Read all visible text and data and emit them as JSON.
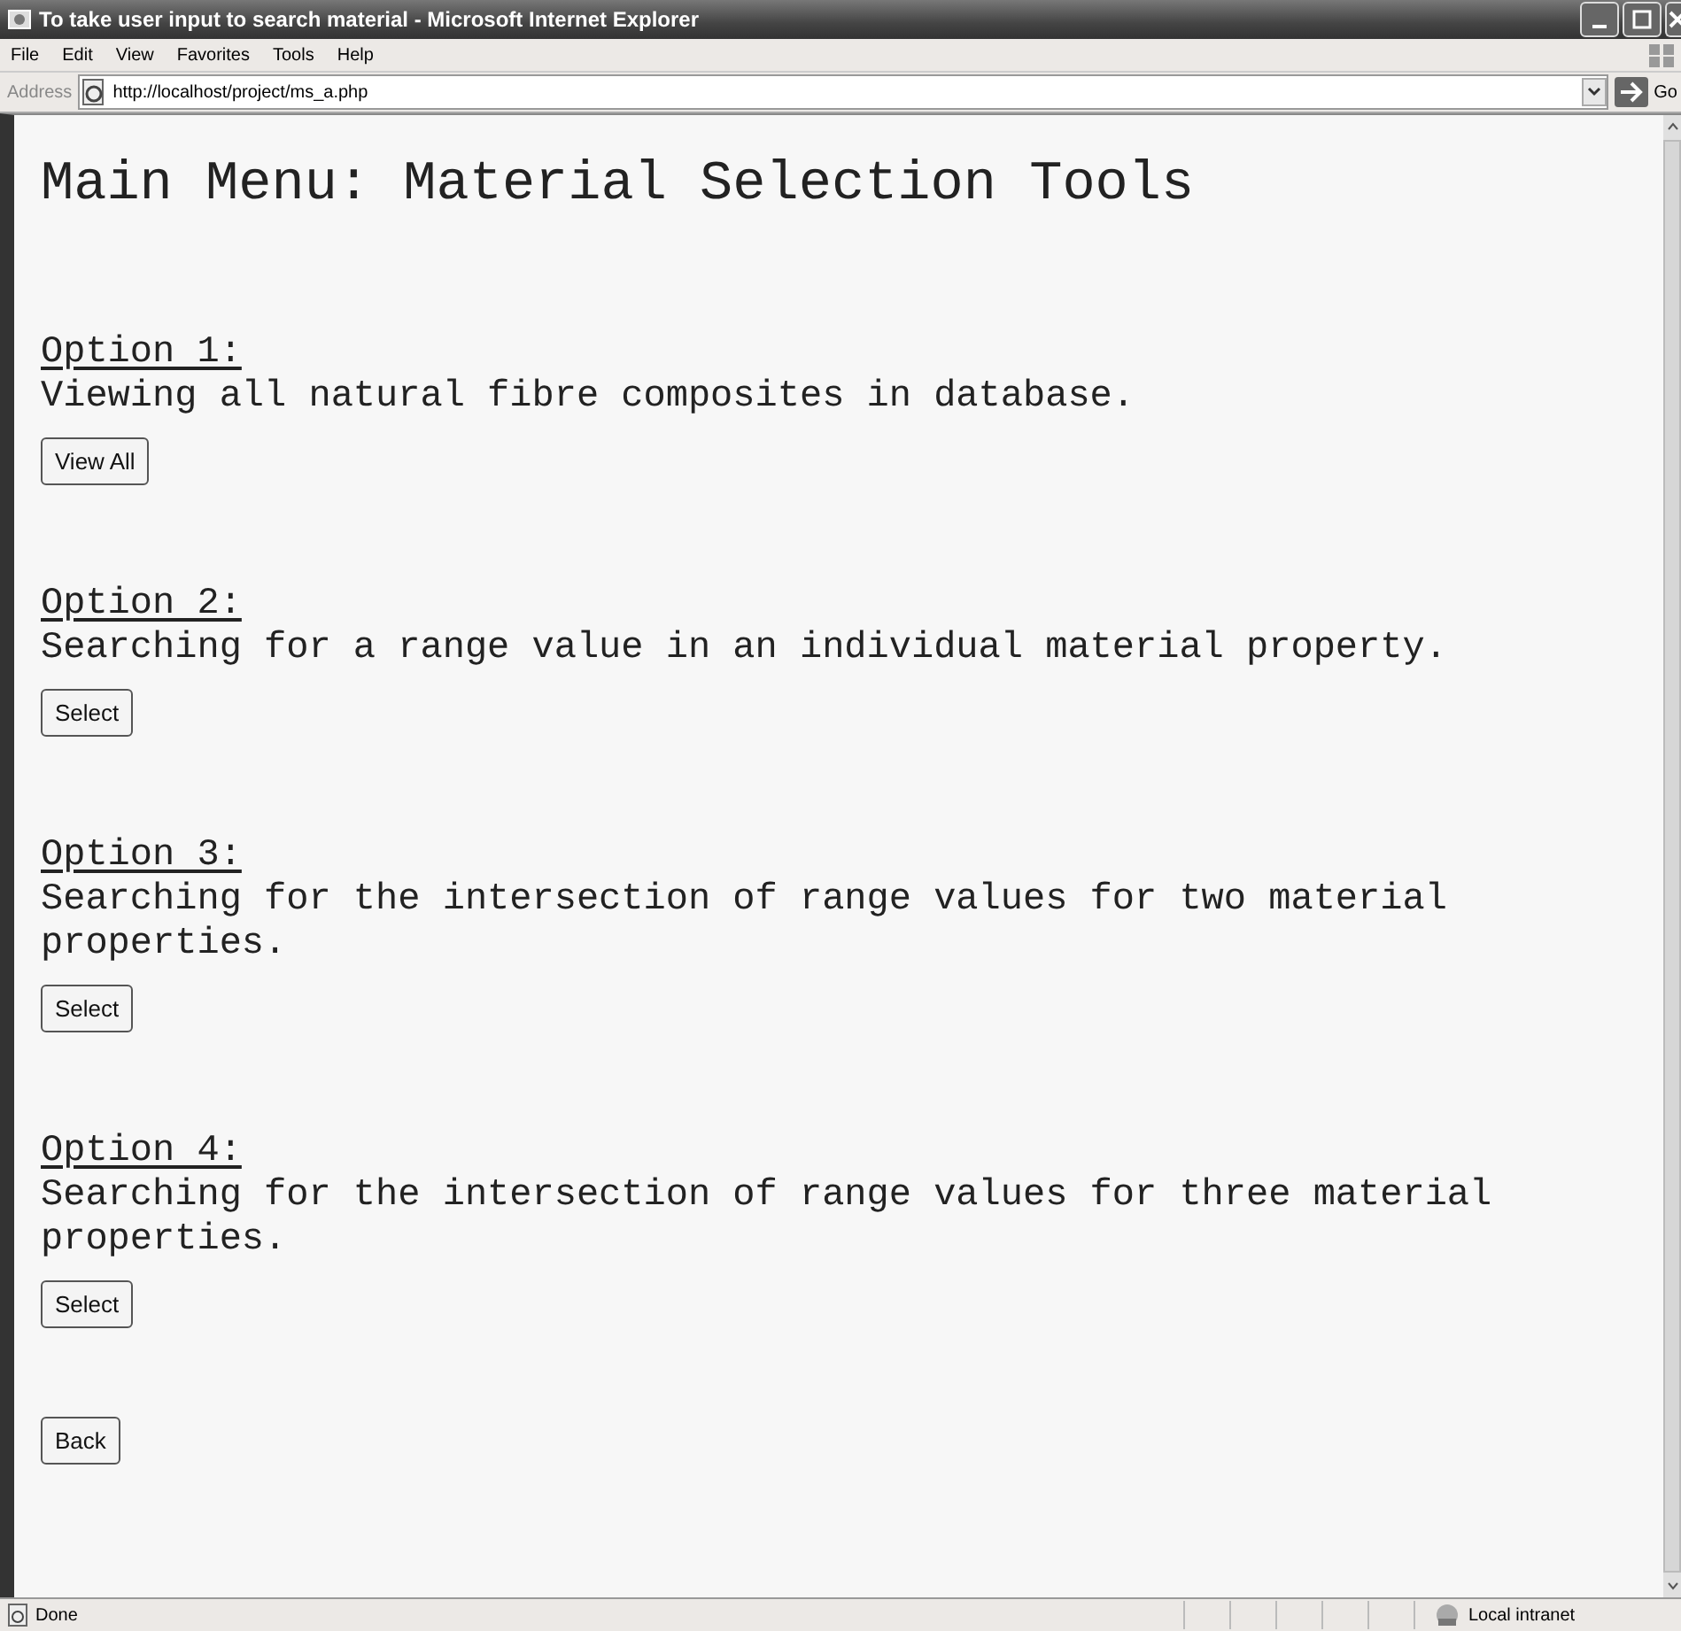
{
  "window": {
    "title": "To take user input to search material - Microsoft Internet Explorer"
  },
  "menu": [
    "File",
    "Edit",
    "View",
    "Favorites",
    "Tools",
    "Help"
  ],
  "address_bar": {
    "label": "Address",
    "url": "http://localhost/project/ms_a.php",
    "go": "Go"
  },
  "page": {
    "heading": "Main Menu: Material Selection Tools",
    "options": [
      {
        "label": "Option 1:",
        "description": "Viewing all natural fibre composites in database.",
        "button": "View All"
      },
      {
        "label": "Option 2:",
        "description": "Searching for a range value in an individual material property.",
        "button": "Select"
      },
      {
        "label": "Option 3:",
        "description": "Searching for the intersection of range values for two material properties.",
        "button": "Select"
      },
      {
        "label": "Option 4:",
        "description": "Searching for the intersection of range values for three material properties.",
        "button": "Select"
      }
    ],
    "back_button": "Back"
  },
  "status_bar": {
    "text": "Done",
    "zone": "Local intranet"
  }
}
